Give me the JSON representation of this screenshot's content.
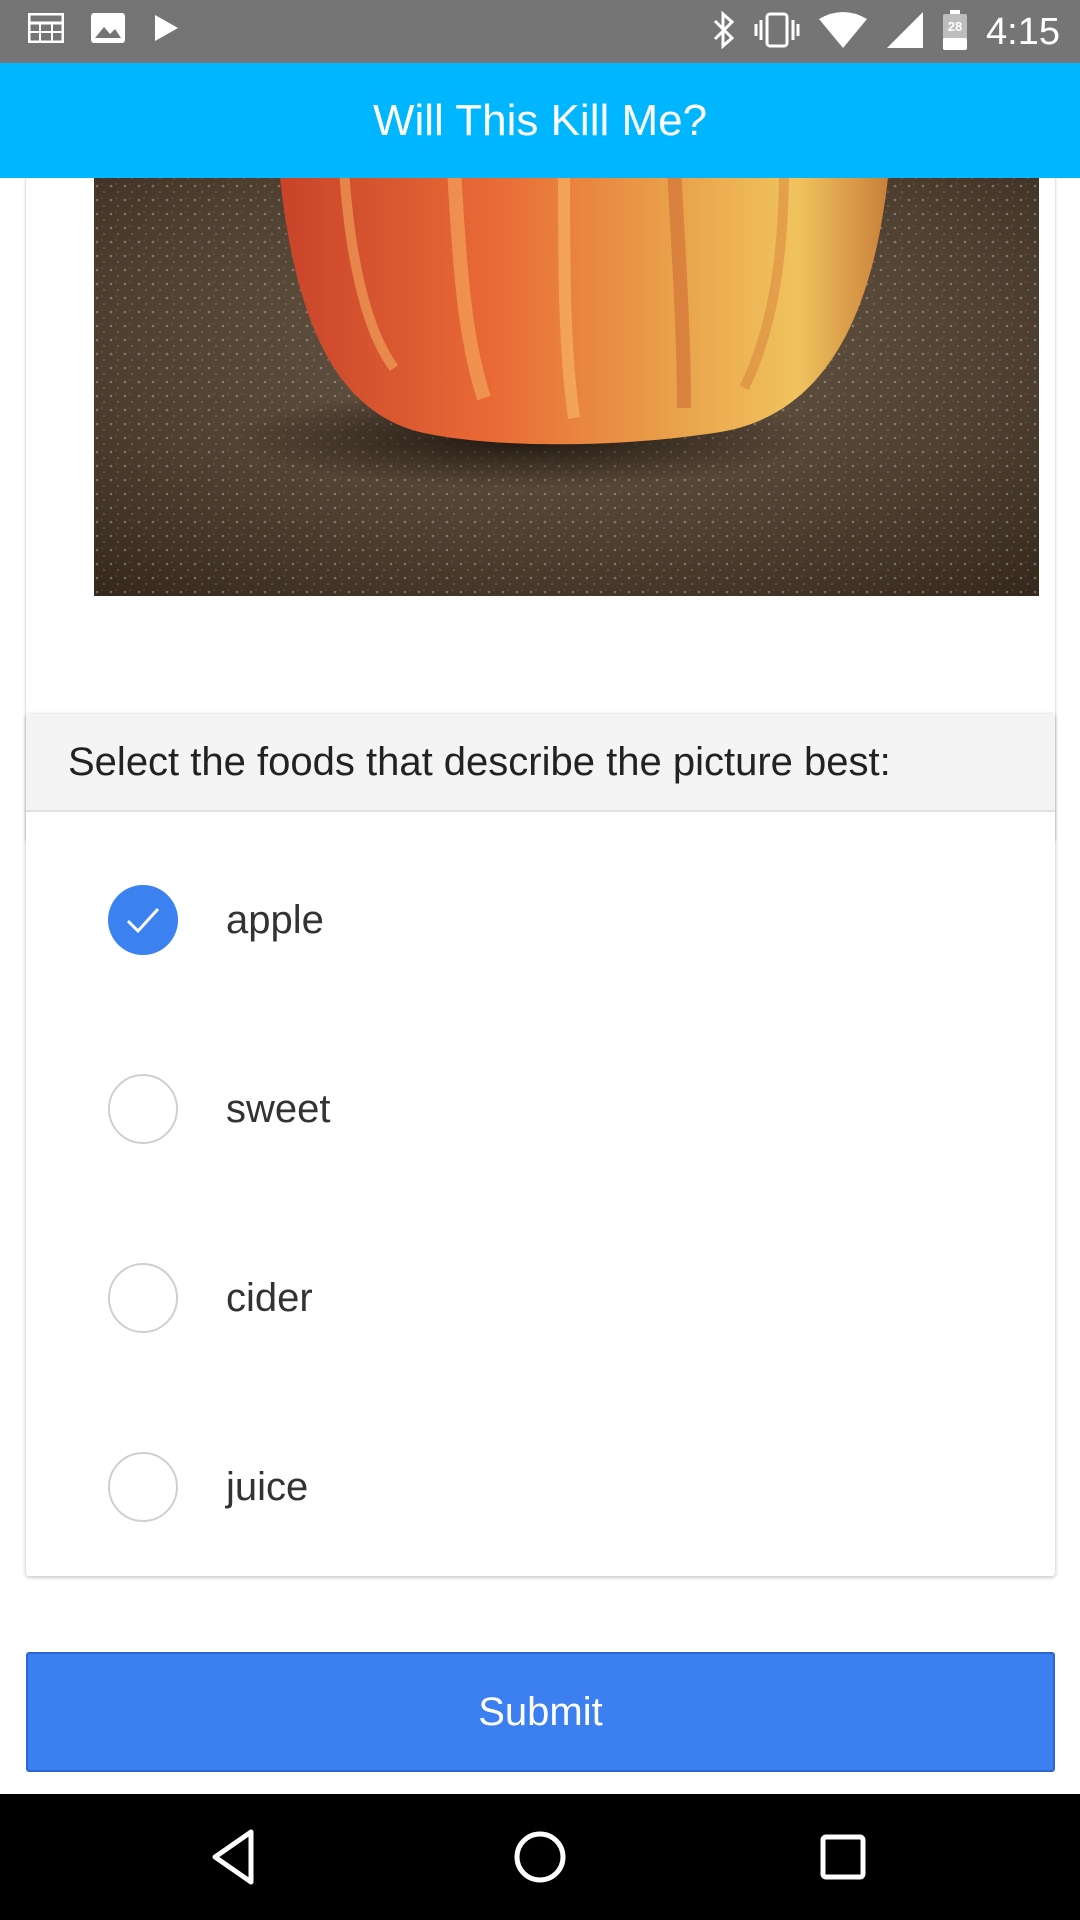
{
  "status_bar": {
    "time": "4:15",
    "battery_level": "28",
    "icons": [
      "calendar-grid-icon",
      "image-icon",
      "play-icon",
      "bluetooth-icon",
      "vibrate-icon",
      "wifi-icon",
      "cell-signal-icon",
      "battery-icon"
    ]
  },
  "app_bar": {
    "title": "Will This Kill Me?"
  },
  "question": {
    "prompt": "Select the foods that describe the picture best:",
    "options": [
      {
        "label": "apple",
        "checked": true
      },
      {
        "label": "sweet",
        "checked": false
      },
      {
        "label": "cider",
        "checked": false
      },
      {
        "label": "juice",
        "checked": false
      }
    ]
  },
  "submit_label": "Submit",
  "colors": {
    "app_bar": "#00b7ff",
    "status_bar": "#757575",
    "accent": "#3b82f0",
    "submit": "#3b7ff0"
  },
  "nav_bar": {
    "icons": [
      "back-icon",
      "home-icon",
      "recents-icon"
    ]
  }
}
